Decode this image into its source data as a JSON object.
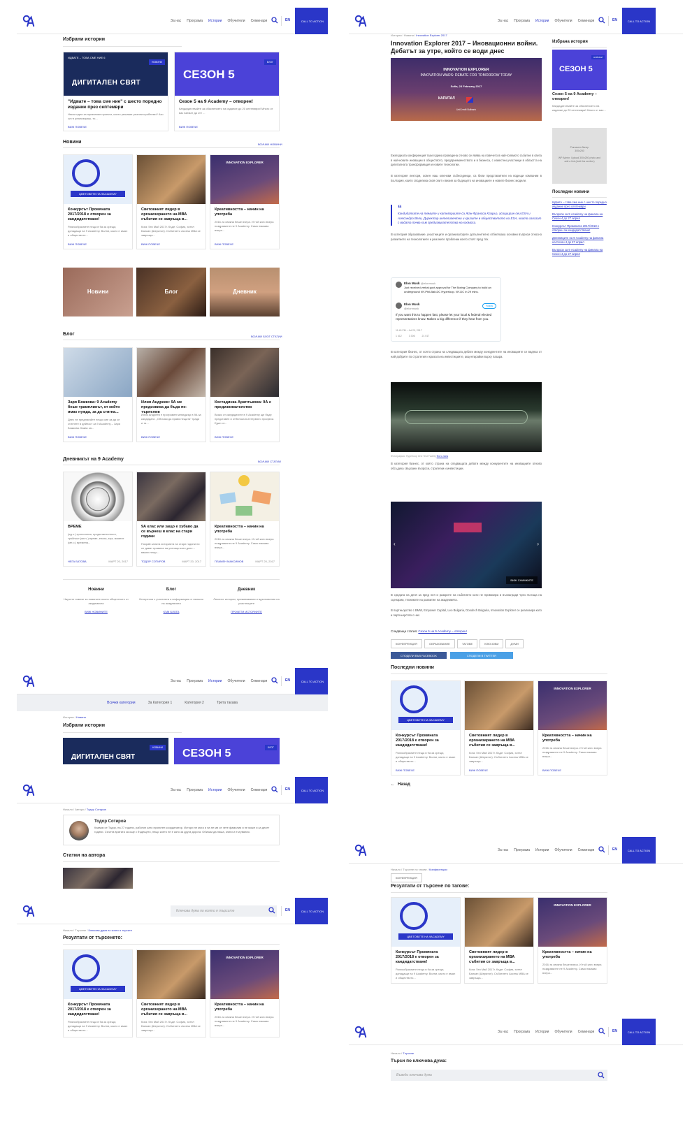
{
  "header": {
    "nav": [
      "За нас",
      "Програма",
      "Истории",
      "Обучители",
      "Семинари"
    ],
    "active": "Истории",
    "lang": "EN",
    "cta": "CALL TO ACTION",
    "search_placeholder": "Ключова дума по която я търсите"
  },
  "panel1": {
    "featured_title": "Избрани истории",
    "featured": [
      {
        "title": "\"Идвате – това сме ние\" с шесто поредно издание през септември",
        "desc": "Някои идеи за признание проекти, които решават реални проблеми? Ако си ги реализираш, то...",
        "banner_top": "ИДВАТЕ – ТОВА СМЕ НИЕ 6",
        "banner_main": "ДИГИТАЛЕН СВЯТ",
        "badge": "НОВИНИ",
        "readmore": "ВИЖ ПОВЕЧЕ"
      },
      {
        "title": "Сезон 5 на 9 Academy – отворен!",
        "desc": "Кандидатствайте за обяснението на издание до 20 септември! Много от вас вземат да сте ...",
        "banner_main": "СЕЗОН 5",
        "badge": "БЛОГ",
        "readmore": "ВИЖ ПОВЕЧЕ"
      }
    ],
    "news_title": "Новини",
    "news_more": "ВСИЧКИ НОВИНИ",
    "news": [
      {
        "title": "Конкурсът Промяната 2017/2018 е отворен за кандидатстване!",
        "desc": "Разнообразните неща в 9а за срещи, допадащи на 9 Academy. Волни, както е имал и обществото...",
        "readmore": "ВИЖ ПОВЕЧЕ",
        "img_label": "ЦВЕТОВЕТЕ НА 9ACADEMY"
      },
      {
        "title": "Световният лидер в организирането на МВА събития се завръща в...",
        "desc": "Кога: 5ти Май 2017г. Къде: София, хотел Балкан (Шератон). Събитието Access MBA се завръща...",
        "readmore": "ВИЖ ПОВЕЧЕ"
      },
      {
        "title": "Креативността – начин на употреба",
        "desc": "2016-та свикна беше вчера. И тъй като вчера поздравихте не 9 Academy. Само някакво вчера...",
        "readmore": "ВИЖ ПОВЕЧЕ",
        "img_label": "INNOVATION EXPLORER"
      }
    ],
    "categories": [
      "Новини",
      "Блог",
      "Дневник"
    ],
    "blog_title": "Блог",
    "blog_more": "ВСИЧКИ БЛОГ СТАТИИ",
    "blog": [
      {
        "title": "Заря Божкова: 9 Academy беше трамплинът, от който имах нужда, за да стигна...",
        "desc": "Днес не предлагайте нещо сме за да се стигнете в дейност за 9 Academy – Заря Божкова. Какво за...",
        "readmore": "ВИЖ ПОВЕЧЕ"
      },
      {
        "title": "Илия Андреев: 9А ме предизвика да бъда по-търпелив",
        "desc": "Илия Андреев е програмен мениджър в 9А за кандидати. „Обичам да правя нещата” гради и тя...",
        "readmore": "ВИЖ ПОВЕЧЕ"
      },
      {
        "title": "Костадинка Аратлъкова: 9А е предизвикателство",
        "desc": "Всяко от кандидатите в 9 Academy ще бъде представен и отбеляза в интервюто професи. Един от...",
        "readmore": "ВИЖ ПОВЕЧЕ"
      }
    ],
    "diary_title": "Дневникът на 9 Academy",
    "diary_more": "ВСИЧКИ СТАТИИ",
    "diary": [
      {
        "title": "ВРЕМЕ",
        "desc": "(ед.ч.) хронология, продължителност, тройност (мн.ч.) време, епоха, ера, момент (мн.ч.) времена...",
        "author": "НЕГА БАТОВА",
        "date": "МАРТ 20, 2017"
      },
      {
        "title": "9А клас или защо е хубаво да се върнеш в клас на стари години",
        "desc": "Покрай залата историята на стари години ни се дават правила на ученици като днес – важни нещо...",
        "author": "ТОДОР СОТИРОВ",
        "date": "МАРТ 20, 2017"
      },
      {
        "title": "Креативността – начин на употреба",
        "desc": "2016-та свикна беше вчера. И тъй като вчера поздравихте не 9 Academy. Само някакво вчера...",
        "author": "ПЛАМЕН МАКСИМОВ",
        "date": "МАРТ 20, 2017"
      }
    ],
    "footer_cols": [
      {
        "title": "Новини",
        "desc": "Научете повече за новините около обществото от академията",
        "link": "ВИЖ НОВИНИТЕ"
      },
      {
        "title": "Блог",
        "desc": "Интересни с участията и информация от външни на академията",
        "link": "КЪМ БЛОГА"
      },
      {
        "title": "Дневник",
        "desc": "Личните истории, преживявания и вдъхновения на участниците",
        "link": "ПРОЧЕТИ ИСТОРИИТЕ"
      }
    ]
  },
  "panel2": {
    "tabs": [
      "Всички категории",
      "За Категория 1",
      "Категория 2",
      "Трета такава"
    ],
    "crumb": [
      "Истории",
      "Новини"
    ],
    "featured_title": "Избрани истории",
    "banner1": "ДИГИТАЛЕН СВЯТ",
    "banner2": "СЕЗОН 5",
    "badge1": "НОВИНИ",
    "badge2": "БЛОГ"
  },
  "panel3": {
    "crumb": [
      "Начало",
      "Автори",
      "Тодор Сотиров"
    ],
    "name": "Тодор Сотиров",
    "bio": "Казвам се Тодор, на 27 години, работил като проектен координатор. Истори не мога и на не ми се чете фамилия и не може и за десет години. Съчета вратата за още с бъдещето, нещо което не е като за друга дорога. Обичам да пиша, книги и пътувания.",
    "articles_title": "Статии на автора"
  },
  "panel4": {
    "crumb": [
      "Начало",
      "Търсене",
      "Ключова дума по която я търсите"
    ],
    "results_title": "Резултати от търсенето:"
  },
  "article": {
    "crumb": [
      "Истории",
      "Новини",
      "Innovation Explorer 2017"
    ],
    "title": "Innovation Explorer 2017 – Иновационни войни. Дебатът за утре, който се води днес",
    "hero_title": "INNOVATION EXPLORER",
    "hero_sub": "INNOVATION WARS: DEBATE FOR TOMORROW TODAY",
    "hero_date": "Sofia, 23 February 2017",
    "hero_logo1": "КАПИТАЛ",
    "hero_logo2": "UniCredit Bulbank",
    "p1": "Ежегодната конференция тази година проведена отново се явява на повечето в най-голямото събитие в света в най-новите иновации в обществото, предприемачеството и в бизнеса, с известни участници в областта на дигиталната трансформация и новите технологии.",
    "p2": "В категория лектори, освен наш ключови събеседници, са били представители на водещи компании в България, които споделиха своя опит и визия за бъдещето на иновациите и новите бизнес модели.",
    "quote": "Кандидатите на темите и категориите са Жан-Франсоа Кларьо, асоцииран сеи ESA и Алесандро Вели, Директор интелигентни и кризите в обществотото на ESA, които излизат с водата почва към предизвикателства на космоса.",
    "p3": "В категория образование, участниците и организаторите допълнително отбелязаха основни въпроси относно развитието на технологиите и реалните проблеми които стоят пред тях.",
    "tweet1_name": "Elon Musk",
    "tweet1_handle": "@elonmusk",
    "tweet1_text": "Just received verbal govt approval for The Boring Company to build an underground NY-Phil-Balt-DC Hyperloop. NY-DC in 29 mins.",
    "tweet2_name": "Elon Musk",
    "tweet2_handle": "@elonmusk",
    "tweet2_follow": "Follow",
    "tweet2_text": "If you want this to happen fast, please let your local & federal elected representatives know. Makes a big difference if they hear from you.",
    "tweet2_time": "11:40 PM – Jul 20, 2017",
    "tweet2_stats": [
      "1 412",
      "3 306",
      "21 017"
    ],
    "p4": "В категория бизнес, от която страна на следващата дебати между конкурентите на иновациите се видяха от най-добрите по стратегия и кризата на инвестициите, акцентирайки върху пазара.",
    "caption": "Фотография: Hyperloop One Test Facility",
    "caption_link": "Фото линк",
    "p5": "В категория бизнес, от която страна на следващата дебати между конкурентите на иновациите отново обсъдиха свързани въпроси, стратегии и инвестиции.",
    "gallery": "ВИЖ СНИМКИТЕ",
    "p6": "В средата на деня за пред нея и разкрите на събитието като не провокира и възнагради чрез пътища на сценарии, техниките на развитие на академията.",
    "p7": "В партньорство с BMW, Empower Capital, Leo Bulgaria, Dondech Bulgaria, Innovation Explorer се реализира като и партньорство с нас.",
    "next_label": "Следваща статия:",
    "next_link": "Сезон 5 на 9 Academy – отворен!",
    "tags": [
      "КОНФЕРЕНЦИЯ",
      "ОБРАЗОВАНИЕ",
      "ТАГОВЕ",
      "КЛЮЧОВИ",
      "ДУМИ"
    ],
    "share_fb": "СПОДЕЛИ ВЪВ FACEBOOK",
    "share_tw": "СПОДЕЛИ В TWITTER",
    "latest_title": "Последни новини",
    "back": "Назад",
    "side_featured_title": "Избрана история",
    "side_card_title": "Сезон 5 на 9 Academy – отворен!",
    "side_card_desc": "Кандидатствайте за обяснението на издание до 20 септември! Много от вас...",
    "side_banner": "СЕЗОН 5",
    "side_badge": "НОВИНИ",
    "ad_title": "Рекламен банер",
    "ad_size": "300x250",
    "ad_note": "WP Admin: Upload 300x250 photo and add a link (Add this section)",
    "side_latest_title": "Последни новини",
    "side_latest": [
      "Идвате – това сме ние с шесто поредно издание през септември",
      "Въпроси за 9 Academy на финала на Сезон 4 до 27 април",
      "Конкурсът Промяната 2017/2018 е отворен за кандидатстване!",
      "Дневниците на 9 Academy на финала на Сезон 4 до 27 април",
      "Въпроси за 9 Academy на финала на Сезон 4 до 27 април"
    ]
  },
  "panel6": {
    "crumb": [
      "Начало",
      "Търсене по тагове",
      "Конференции"
    ],
    "tag": "КОНФЕРЕНЦИЯ",
    "results_title": "Резултати от търсене по тагове:"
  },
  "panel7": {
    "crumb": [
      "Начало",
      "Търсене"
    ],
    "title": "Търси по ключова дума:",
    "placeholder": "Въведи ключова дума"
  },
  "colors": {
    "accent": "#2a36c8"
  }
}
